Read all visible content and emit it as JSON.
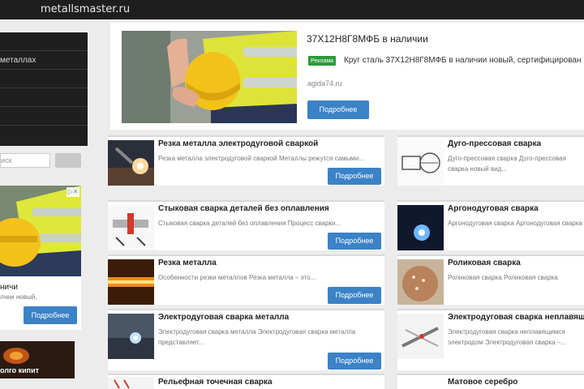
{
  "header": {
    "site_name": "metallsmaster.ru"
  },
  "sidebar": {
    "menu_items": [
      "",
      "металлах",
      "",
      "",
      ""
    ],
    "search_placeholder": "иск"
  },
  "side_ad": {
    "title": "ничи",
    "text": "лчии новый,",
    "button": "Подробнее"
  },
  "side_thumb": {
    "label": "олго кипит"
  },
  "top_ad": {
    "title": "37Х12Н8Г8МФБ в наличии",
    "badge": "Реклама",
    "text": "Круг сталь 37Х12Н8Г8МФБ в наличии новый, сертифицирован",
    "domain": "agida74.ru",
    "button": "Подробнее"
  },
  "articles_left": [
    {
      "title": "Резка металла электродуговой сваркой",
      "text": "Резка металла электродуговой сваркой Металлы режутся самыми...",
      "button": "Подробнее"
    },
    {
      "title": "Стыковая сварка деталей без оплавления",
      "text": "Стыковая сварка деталей без оплавления Процесс сварки...",
      "button": "Подробнее"
    },
    {
      "title": "Резка металла",
      "text": "Особенности резки металлов Резка металла – это...",
      "button": "Подробнее"
    },
    {
      "title": "Электродуговая сварка металла",
      "text": "Электродуговая сварка металла Электродуговая сварка металла представляет...",
      "button": "Подробнее"
    },
    {
      "title": "Рельефная точечная сварка",
      "text": "",
      "button": ""
    }
  ],
  "articles_right": [
    {
      "title": "Дуго-прессовая сварка",
      "text": "Дуго-прессовая сварка Дуго-прессовая сварка новый вид..."
    },
    {
      "title": "Аргонодуговая сварка",
      "text": "Аргонодуговая сварка Аргонодуговая сварка"
    },
    {
      "title": "Роликовая сварка",
      "text": "Роликовая сварка Роликовая сварка"
    },
    {
      "title": "Электродуговая сварка неплавящ",
      "text": "Электродуговая сварка неплавящимся электродом Электродуговая сварка –..."
    },
    {
      "title": "Матовое серебро",
      "text": ""
    }
  ],
  "colors": {
    "accent": "#3b82c7",
    "topbar": "#1e1e1e",
    "badge": "#2c9a3b"
  }
}
